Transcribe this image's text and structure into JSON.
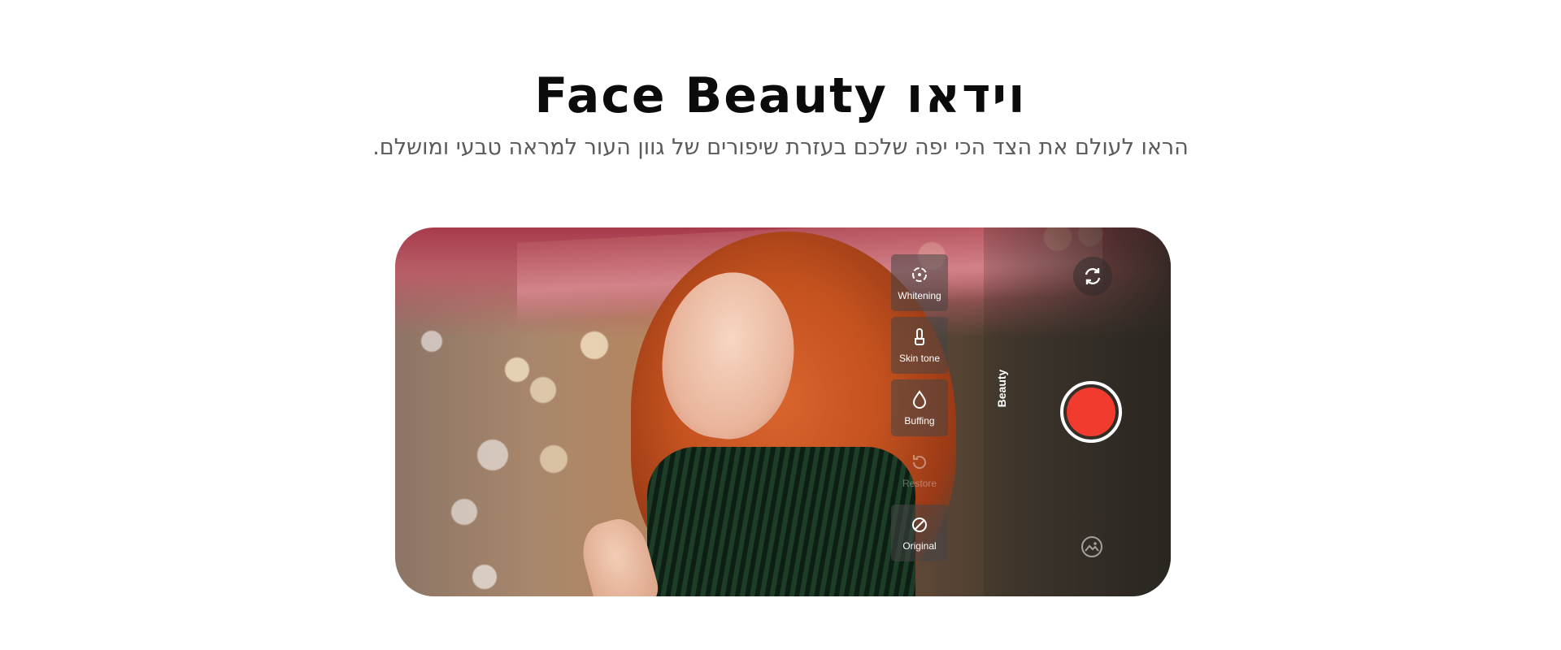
{
  "header": {
    "title": "Face Beauty וידאו",
    "subtitle": "הראו לעולם את הצד הכי יפה שלכם בעזרת שיפורים של גוון העור למראה טבעי ומושלם."
  },
  "camera": {
    "tools": [
      {
        "label": "Whitening",
        "icon": "whitening-icon",
        "enabled": true
      },
      {
        "label": "Skin tone",
        "icon": "skin-tone-icon",
        "enabled": true
      },
      {
        "label": "Buffing",
        "icon": "buffing-icon",
        "enabled": true
      },
      {
        "label": "Restore",
        "icon": "restore-icon",
        "enabled": false
      },
      {
        "label": "Original",
        "icon": "original-icon",
        "enabled": true
      }
    ],
    "mode_label": "Beauty",
    "shutter_color": "#f23b2f",
    "flip_icon": "switch-camera-icon",
    "gallery_icon": "gallery-icon"
  }
}
